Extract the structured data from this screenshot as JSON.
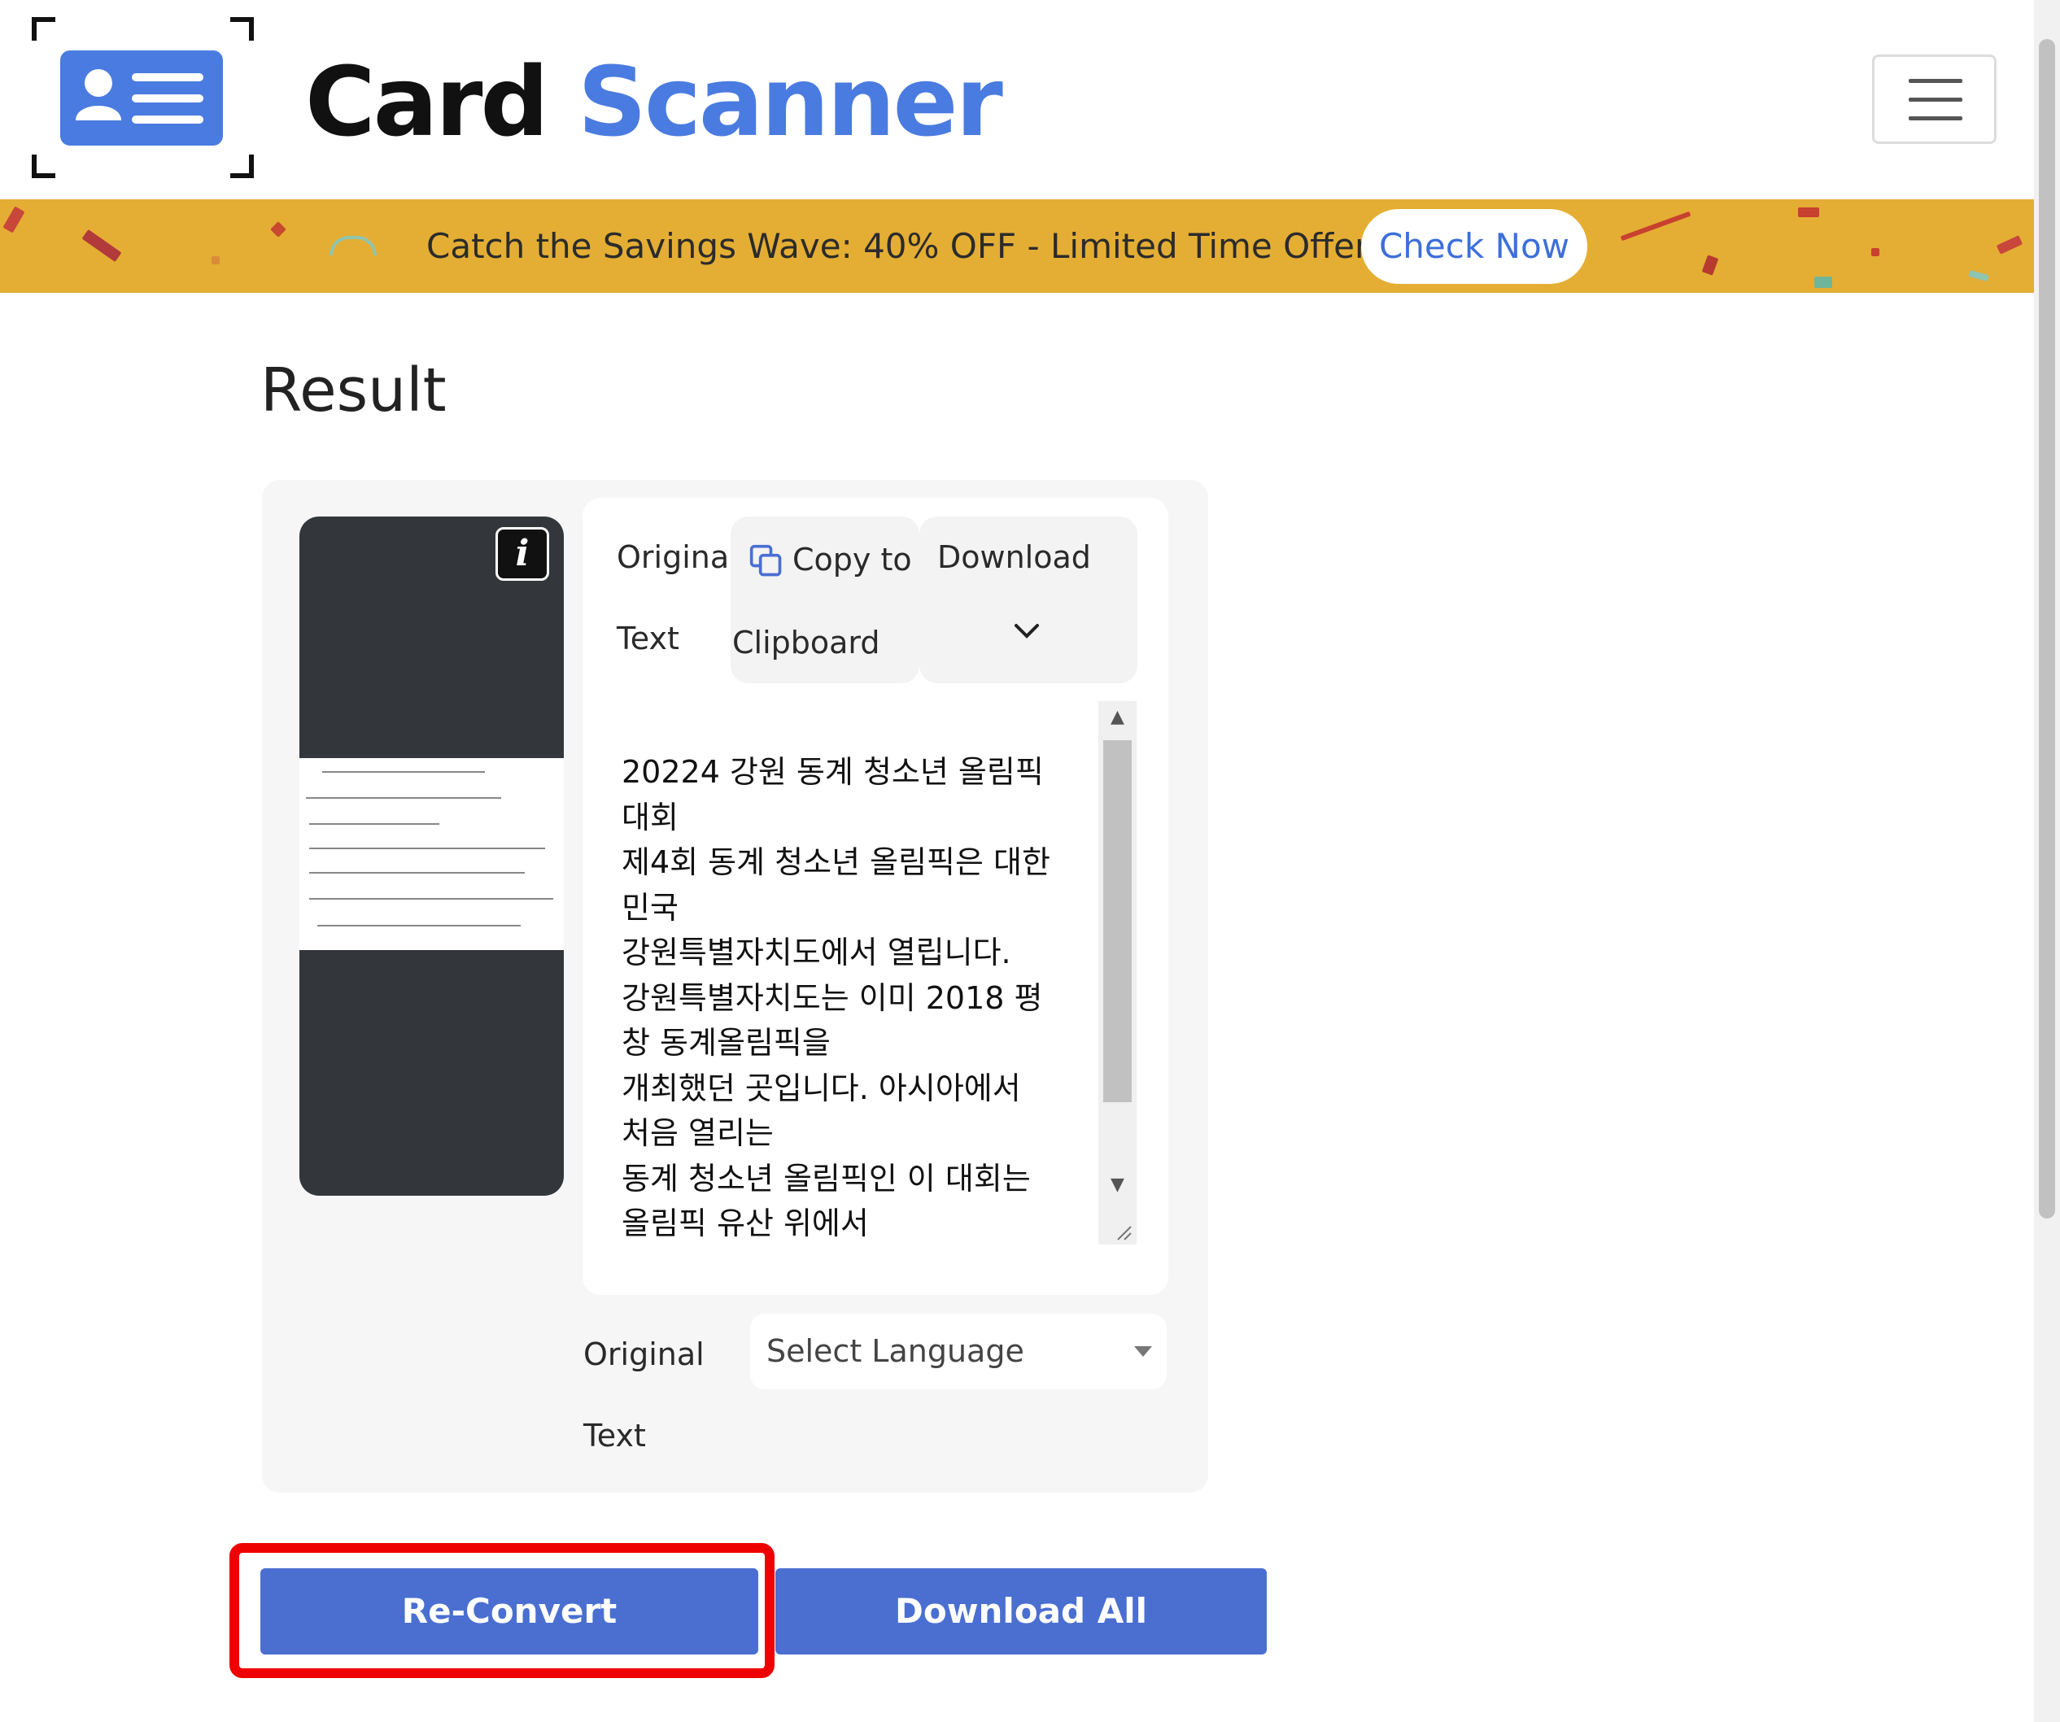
{
  "header": {
    "brand_word1": "Card",
    "brand_word2": "Scanner",
    "menu_icon": "hamburger-menu-icon",
    "logo_icon": "id-card-scan-icon"
  },
  "banner": {
    "text": "Catch the Savings Wave: 40% OFF - Limited Time Offer",
    "button": "Check Now",
    "background": "#e4ae34"
  },
  "result": {
    "title": "Result",
    "info_icon": "i",
    "toolbar": {
      "label_line1": "Original",
      "label_line2": "Text",
      "copy_line1": "Copy to",
      "copy_line2": "Clipboard",
      "download_label": "Download"
    },
    "extracted_text": [
      "20224 강원 동계 청소년 올림픽",
      "대회",
      "제4회 동계 청소년 올림픽은 대한",
      "민국",
      "강원특별자치도에서 열립니다.",
      "강원특별자치도는 이미 2018 평",
      "창 동계올림픽을",
      "개최했던 곳입니다. 아시아에서",
      "처음 열리는",
      "동계 청소년 올림픽인 이 대회는",
      "올림픽 유산 위에서"
    ],
    "language": {
      "label_line1": "Original",
      "label_line2": "Text",
      "placeholder": "Select Language"
    }
  },
  "actions": {
    "reconvert": "Re-Convert",
    "download_all": "Download All"
  },
  "colors": {
    "accent": "#4a6fd1",
    "brand_blue": "#4a7be0",
    "highlight": "#ef0000"
  }
}
